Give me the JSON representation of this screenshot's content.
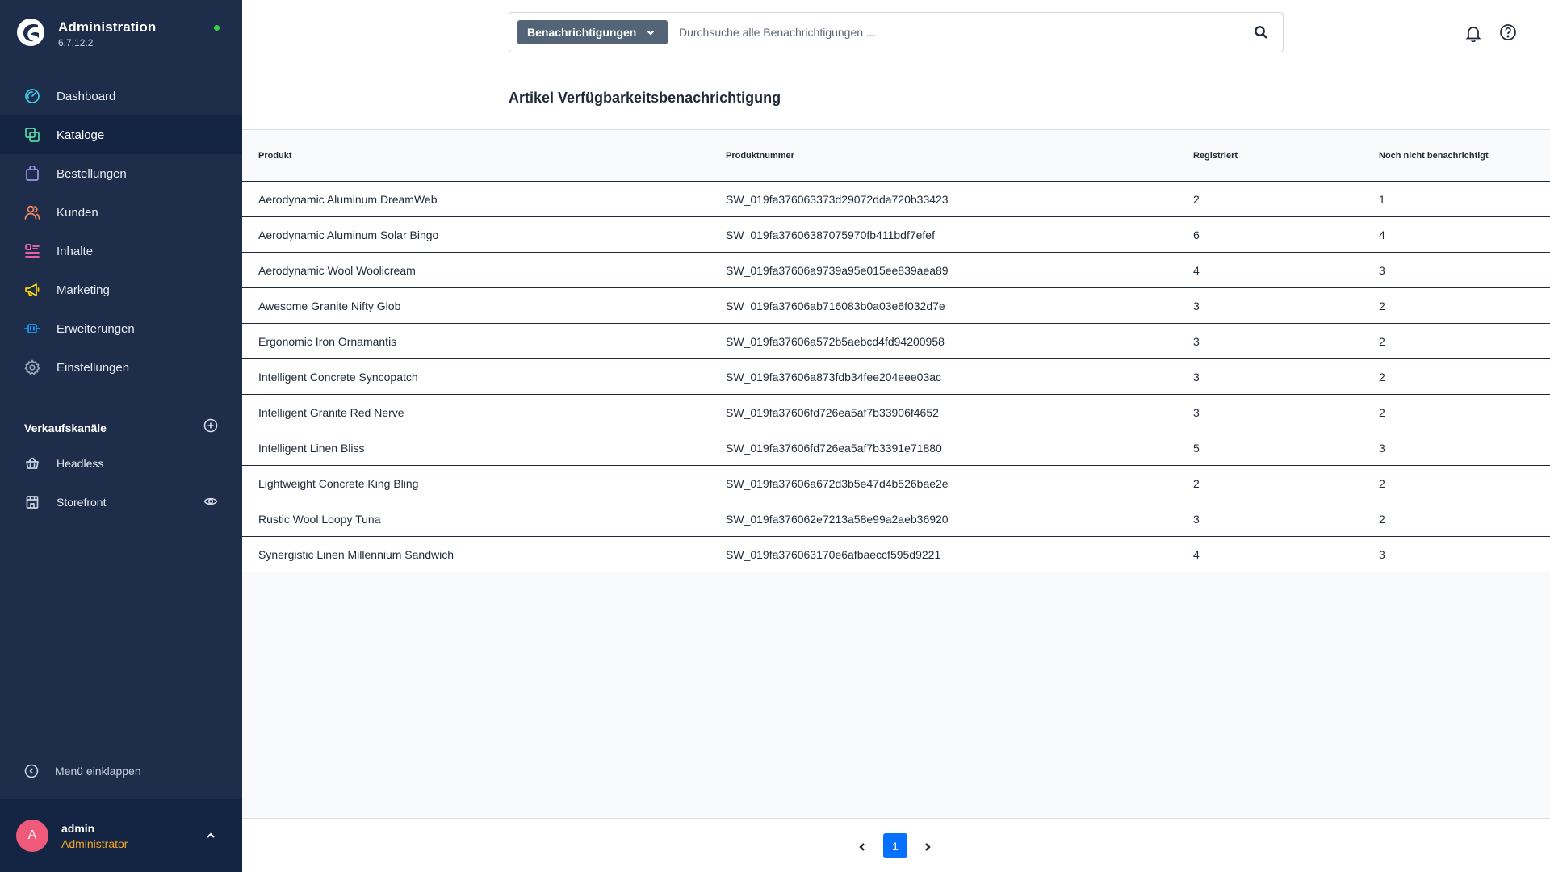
{
  "brand": {
    "title": "Administration",
    "version": "6.7.12.2"
  },
  "nav": [
    {
      "label": "Dashboard",
      "icon": "dashboard-icon",
      "color": "#3ec8e9",
      "active": false
    },
    {
      "label": "Kataloge",
      "icon": "catalog-icon",
      "color": "#57d9a3",
      "active": true
    },
    {
      "label": "Bestellungen",
      "icon": "shopping-bag-icon",
      "color": "#a092f0",
      "active": false
    },
    {
      "label": "Kunden",
      "icon": "users-icon",
      "color": "#f88962",
      "active": false
    },
    {
      "label": "Inhalte",
      "icon": "content-icon",
      "color": "#ff68b4",
      "active": false
    },
    {
      "label": "Marketing",
      "icon": "megaphone-icon",
      "color": "#ffd700",
      "active": false
    },
    {
      "label": "Erweiterungen",
      "icon": "plug-icon",
      "color": "#189eff",
      "active": false
    },
    {
      "label": "Einstellungen",
      "icon": "gear-icon",
      "color": "#9aa8b5",
      "active": false
    }
  ],
  "sales_channels": {
    "title": "Verkaufskanäle",
    "items": [
      {
        "label": "Headless",
        "icon": "basket-icon"
      },
      {
        "label": "Storefront",
        "icon": "storefront-icon"
      }
    ]
  },
  "collapse_label": "Menü einklappen",
  "user": {
    "initial": "A",
    "name": "admin",
    "role": "Administrator"
  },
  "search": {
    "type_label": "Benachrichtigungen",
    "placeholder": "Durchsuche alle Benachrichtigungen ..."
  },
  "page_title": "Artikel Verfügbarkeitsbenachrichtigung",
  "table": {
    "columns": [
      "Produkt",
      "Produktnummer",
      "Registriert",
      "Noch nicht benachrichtigt"
    ],
    "rows": [
      [
        "Aerodynamic Aluminum DreamWeb",
        "SW_019fa376063373d29072dda720b33423",
        "2",
        "1"
      ],
      [
        "Aerodynamic Aluminum Solar Bingo",
        "SW_019fa37606387075970fb411bdf7efef",
        "6",
        "4"
      ],
      [
        "Aerodynamic Wool Woolicream",
        "SW_019fa37606a9739a95e015ee839aea89",
        "4",
        "3"
      ],
      [
        "Awesome Granite Nifty Glob",
        "SW_019fa37606ab716083b0a03e6f032d7e",
        "3",
        "2"
      ],
      [
        "Ergonomic Iron Ornamantis",
        "SW_019fa37606a572b5aebcd4fd94200958",
        "3",
        "2"
      ],
      [
        "Intelligent Concrete Syncopatch",
        "SW_019fa37606a873fdb34fee204eee03ac",
        "3",
        "2"
      ],
      [
        "Intelligent Granite Red Nerve",
        "SW_019fa37606fd726ea5af7b33906f4652",
        "3",
        "2"
      ],
      [
        "Intelligent Linen Bliss",
        "SW_019fa37606fd726ea5af7b3391e71880",
        "5",
        "3"
      ],
      [
        "Lightweight Concrete King Bling",
        "SW_019fa37606a672d3b5e47d4b526bae2e",
        "2",
        "2"
      ],
      [
        "Rustic Wool Loopy Tuna",
        "SW_019fa376062e7213a58e99a2aeb36920",
        "3",
        "2"
      ],
      [
        "Synergistic Linen Millennium Sandwich",
        "SW_019fa376063170e6afbaeccf595d9221",
        "4",
        "3"
      ]
    ]
  },
  "pagination": {
    "current_page": "1"
  }
}
